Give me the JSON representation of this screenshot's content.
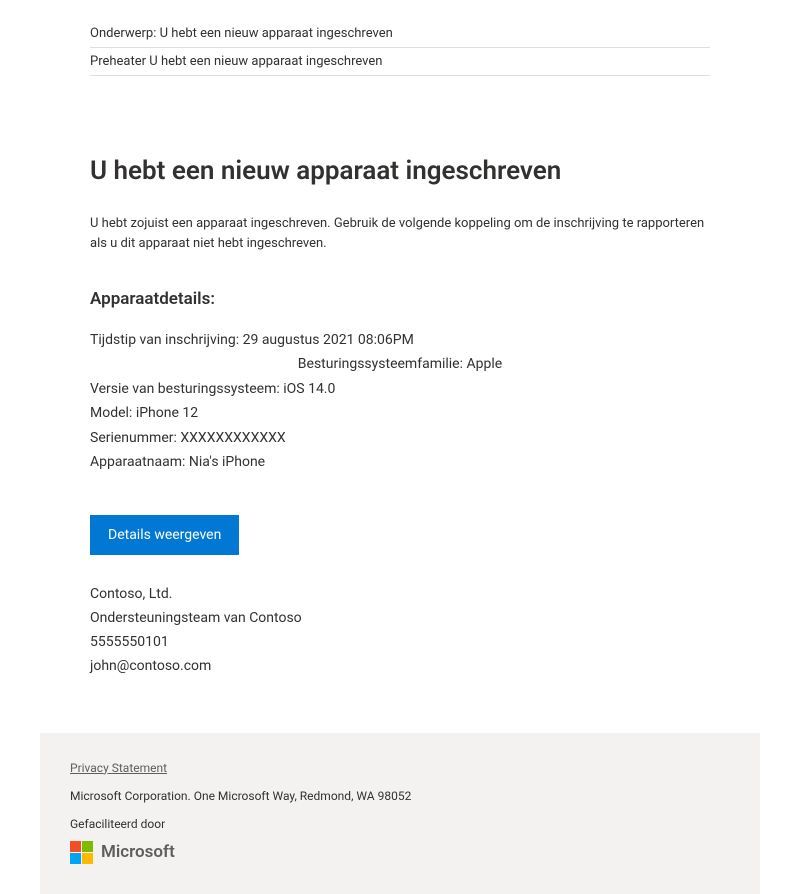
{
  "header": {
    "subject_label": "Onderwerp:",
    "subject_value": "U hebt een nieuw apparaat ingeschreven",
    "preheader_label": "Preheater",
    "preheader_value": "U hebt een nieuw apparaat ingeschreven"
  },
  "main": {
    "title": "U hebt een nieuw apparaat ingeschreven",
    "intro": "U hebt zojuist een apparaat ingeschreven. Gebruik de volgende koppeling om de inschrijving te rapporteren als u dit apparaat niet hebt ingeschreven.",
    "details_heading": "Apparaatdetails:",
    "details": {
      "enroll_time_label": "Tijdstip van inschrijving:",
      "enroll_time_value": "29 augustus 2021 08:06PM",
      "os_family_label": "Besturingssysteemfamilie:",
      "os_family_value": "Apple",
      "os_version_label": "Versie van besturingssysteem:",
      "os_version_value": "iOS 14.0",
      "model_label": "Model:",
      "model_value": "iPhone 12",
      "serial_label": "Serienummer:",
      "serial_value": "XXXXXXXXXXXX",
      "device_name_label": "Apparaatnaam:",
      "device_name_value": "Nia's iPhone"
    },
    "button_label": "Details weergeven",
    "contact": {
      "company": "Contoso, Ltd.",
      "team": "Ondersteuningsteam van Contoso",
      "phone": "5555550101",
      "email": "john@contoso.com"
    }
  },
  "footer": {
    "privacy_label": "Privacy Statement",
    "address": "Microsoft Corporation. One Microsoft Way, Redmond, WA 98052",
    "facilitated_by": "Gefaciliteerd door",
    "logo_text": "Microsoft"
  }
}
